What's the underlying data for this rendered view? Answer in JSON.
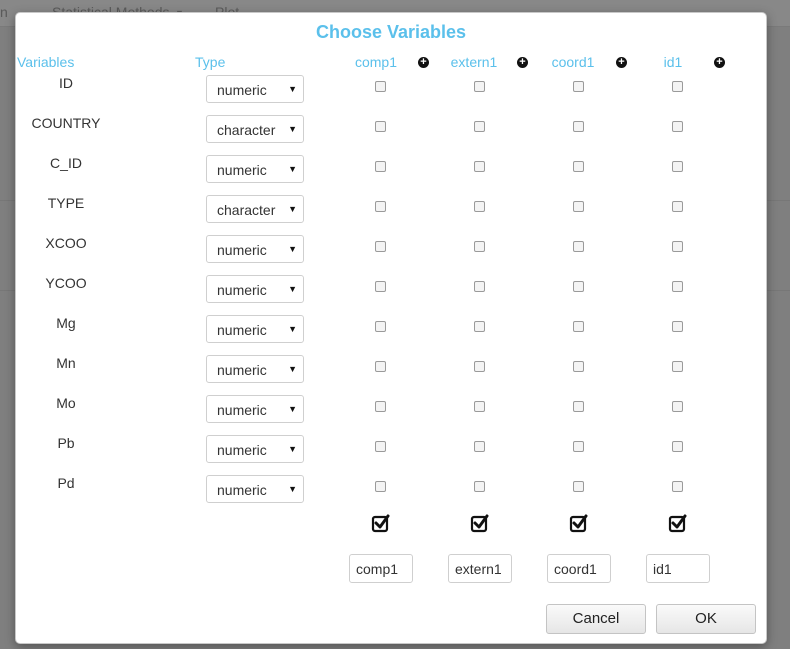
{
  "background": {
    "nav_items": [
      "n",
      "Statistical Methods",
      "Plot"
    ]
  },
  "dialog": {
    "title": "Choose Variables",
    "headers": {
      "variables": "Variables",
      "type": "Type"
    },
    "columns": [
      "comp1",
      "extern1",
      "coord1",
      "id1"
    ],
    "rows": [
      {
        "name": "ID",
        "type": "numeric"
      },
      {
        "name": "COUNTRY",
        "type": "character"
      },
      {
        "name": "C_ID",
        "type": "numeric"
      },
      {
        "name": "TYPE",
        "type": "character"
      },
      {
        "name": "XCOO",
        "type": "numeric"
      },
      {
        "name": "YCOO",
        "type": "numeric"
      },
      {
        "name": "Mg",
        "type": "numeric"
      },
      {
        "name": "Mn",
        "type": "numeric"
      },
      {
        "name": "Mo",
        "type": "numeric"
      },
      {
        "name": "Pb",
        "type": "numeric"
      },
      {
        "name": "Pd",
        "type": "numeric"
      }
    ],
    "group_name_inputs": [
      "comp1",
      "extern1",
      "coord1",
      "id1"
    ],
    "buttons": {
      "cancel": "Cancel",
      "ok": "OK"
    },
    "icons": {
      "add_group": "plus-circle-icon",
      "select_all": "check-square-icon"
    },
    "colors": {
      "accent": "#5bc0eb"
    }
  }
}
